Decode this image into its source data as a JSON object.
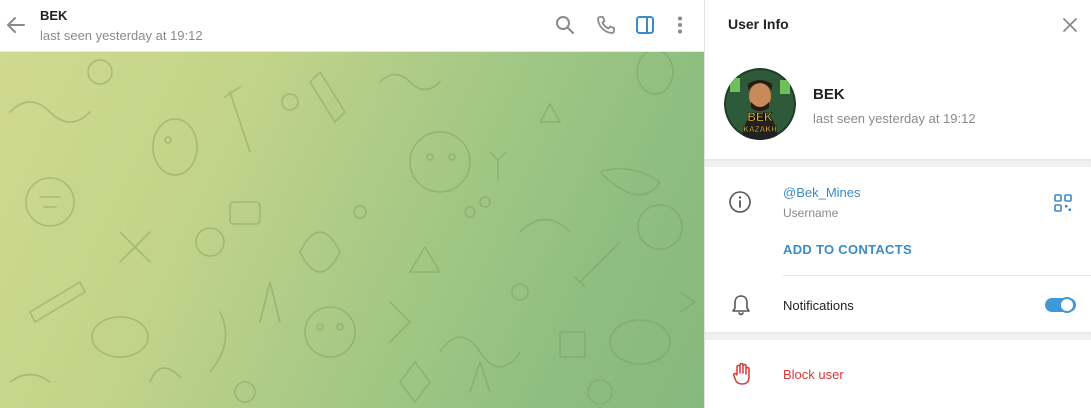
{
  "chat": {
    "title": "BEK",
    "status": "last seen yesterday at 19:12",
    "icons": [
      "back-arrow-icon",
      "search-icon",
      "phone-icon",
      "sidebar-toggle-icon",
      "more-vertical-icon"
    ]
  },
  "panel": {
    "title": "User Info",
    "close_icon": "close-icon",
    "user": {
      "name": "BEK",
      "status": "last seen yesterday at 19:12",
      "avatar_text_top": "BEK",
      "avatar_text_bottom": "KAZAKH"
    },
    "username_value": "@Bek_Mines",
    "username_label": "Username",
    "add_contacts_label": "ADD TO CONTACTS",
    "notifications_label": "Notifications",
    "notifications_on": true,
    "block_label": "Block user"
  },
  "colors": {
    "accent": "#3a8bc8",
    "toggle": "#3f99d8",
    "danger": "#d23b3b",
    "muted": "#8a8a8a"
  }
}
